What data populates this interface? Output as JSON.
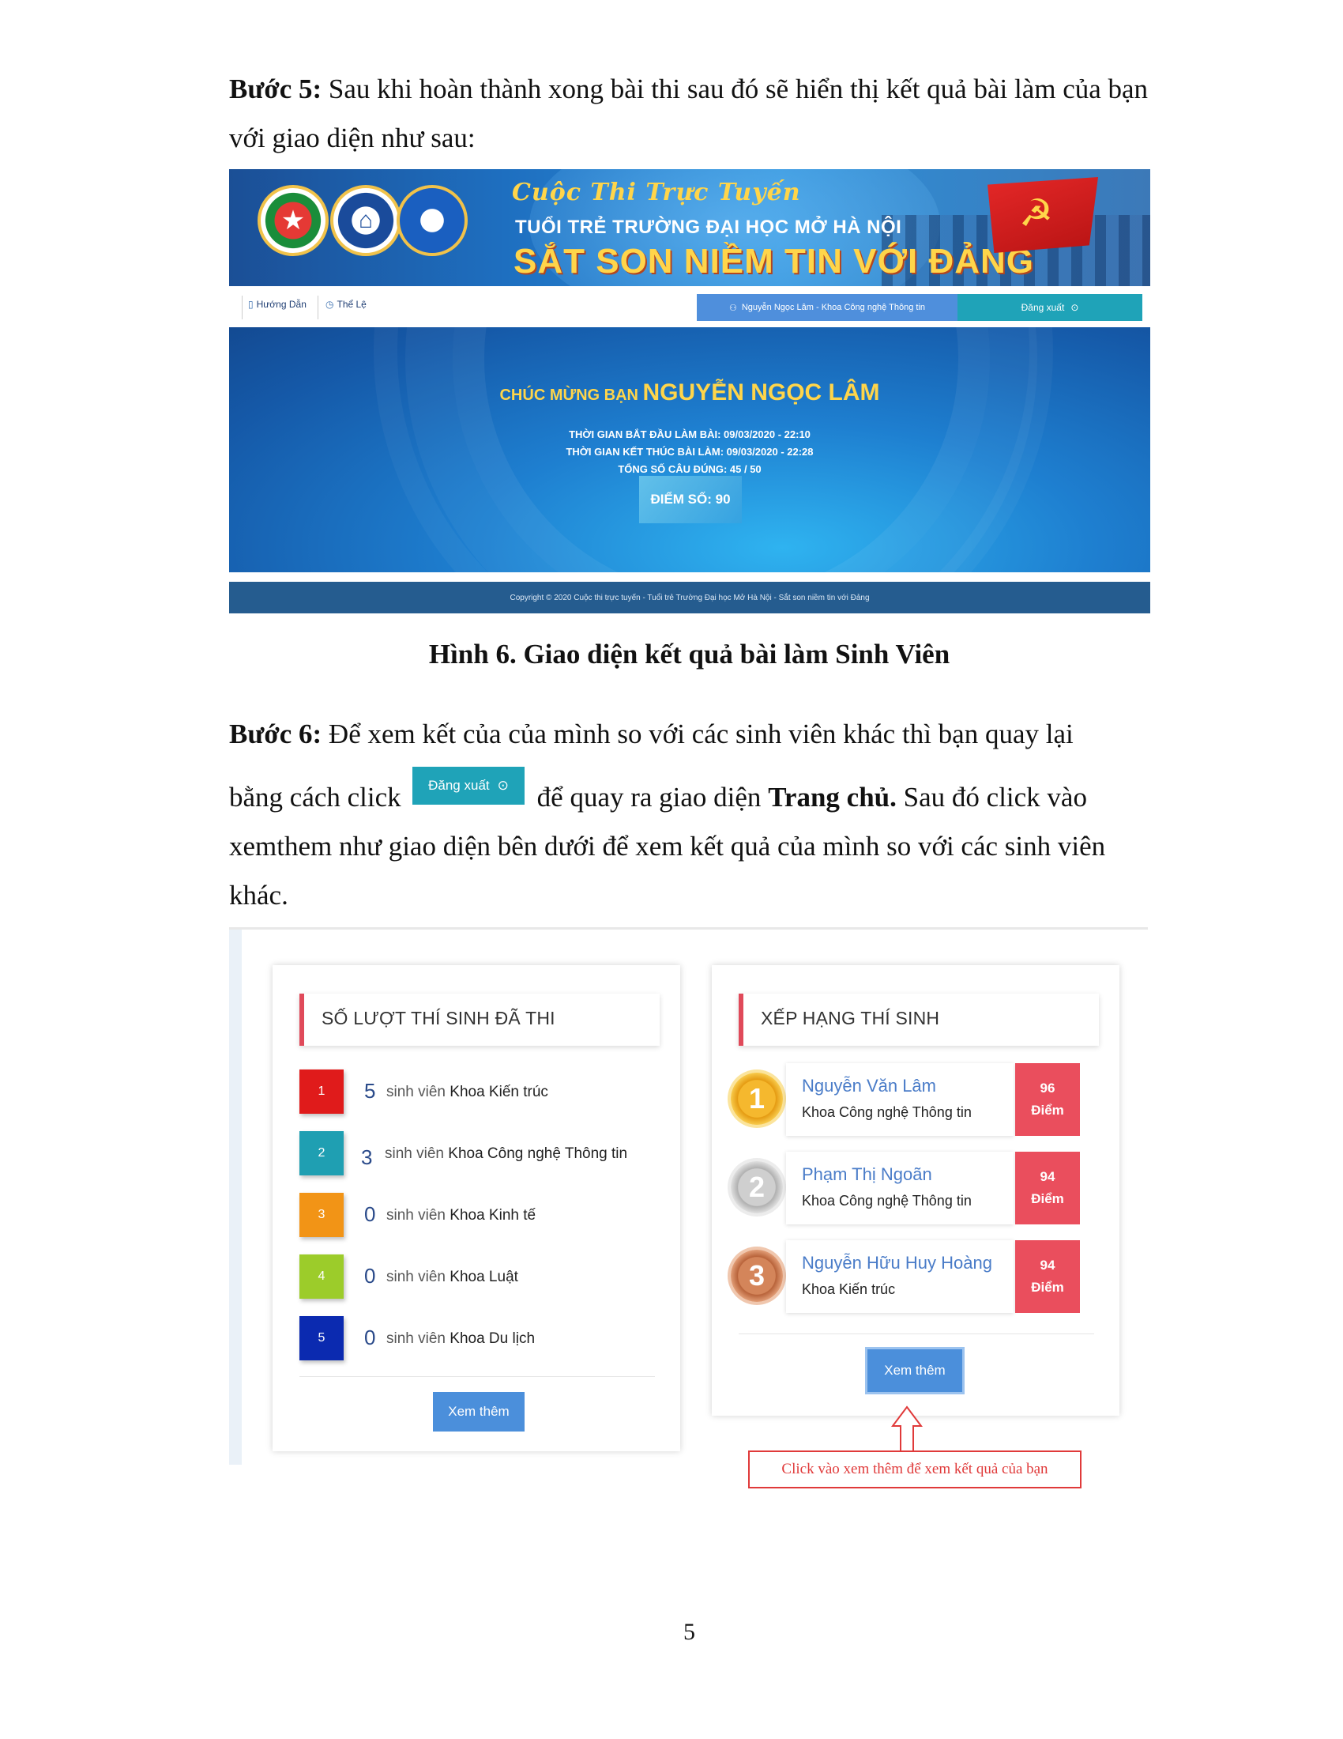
{
  "doc": {
    "step5_label": "Bước 5:",
    "step5_text": " Sau khi hoàn thành xong bài thi sau đó sẽ hiển thị kết quả bài làm của bạn với giao diện như sau:",
    "figure_caption": "Hình  6. Giao diện kết quả bài làm Sinh Viên",
    "step6_label": "Bước 6:",
    "step6_text_a": " Để xem kết của của mình so với các sinh viên khác thì bạn quay lại",
    "step6_text_b": "bằng cách click",
    "step6_text_c": "để quay ra giao diện ",
    "step6_bold": "Trang chủ.",
    "step6_text_d": " Sau đó click vào",
    "step6_text_e": "xemthem như giao diện bên dưới để xem kết quả của mình so với các sinh viên khác.",
    "page_number": "5"
  },
  "shot1": {
    "banner": {
      "line1": "Cuộc Thi Trực Tuyến",
      "line2": "TUỔI TRẺ TRƯỜNG ĐẠI HỌC MỞ HÀ NỘI",
      "line3": "SẮT SON NIỀM TIN VỚI ĐẢNG"
    },
    "nav": {
      "guide": "Hướng Dẫn",
      "rules": "Thể Lệ",
      "user": "Nguyễn Ngọc Lâm - Khoa Công nghệ Thông tin",
      "logout": "Đăng xuất"
    },
    "result": {
      "congrats_prefix": "CHÚC MỪNG BẠN ",
      "name": "NGUYỄN NGỌC LÂM",
      "start": "THỜI GIAN BẮT ĐẦU LÀM BÀI: 09/03/2020 - 22:10",
      "end": "THỜI GIAN KẾT THÚC BÀI LÀM: 09/03/2020 - 22:28",
      "correct": "TỔNG SỐ CÂU ĐÚNG: 45 / 50",
      "score": "ĐIỂM SỐ: 90"
    },
    "footer": "Copyright © 2020 Cuộc thi trực tuyến - Tuổi trẻ Trường Đại học Mở Hà Nội - Sắt son niềm tin với Đảng"
  },
  "inline_button": {
    "label": "Đăng xuất"
  },
  "shot2": {
    "stats": {
      "title": "SỐ LƯỢT THÍ SINH ĐÃ THI",
      "unit": "sinh viên",
      "rows": [
        {
          "rank": "1",
          "count": "5",
          "dept": "Khoa Kiến trúc",
          "color": "#e01b1b"
        },
        {
          "rank": "2",
          "count": "3",
          "dept": "Khoa Công nghệ Thông tin",
          "color": "#1f9fb2"
        },
        {
          "rank": "3",
          "count": "0",
          "dept": "Khoa Kinh tế",
          "color": "#f29416"
        },
        {
          "rank": "4",
          "count": "0",
          "dept": "Khoa Luật",
          "color": "#9ccc2a"
        },
        {
          "rank": "5",
          "count": "0",
          "dept": "Khoa Du lịch",
          "color": "#0b2ab0"
        }
      ],
      "more": "Xem thêm"
    },
    "ranking": {
      "title": "XẾP HẠNG THÍ SINH",
      "rows": [
        {
          "place": "1",
          "name": "Nguyễn Văn Lâm",
          "dept": "Khoa Công nghệ Thông tin",
          "score": "96",
          "unit": "Điểm"
        },
        {
          "place": "2",
          "name": "Phạm Thị Ngoãn",
          "dept": "Khoa Công nghệ Thông tin",
          "score": "94",
          "unit": "Điểm"
        },
        {
          "place": "3",
          "name": "Nguyễn Hữu Huy Hoàng",
          "dept": "Khoa Kiến trúc",
          "score": "94",
          "unit": "Điểm"
        }
      ],
      "more": "Xem thêm"
    },
    "note": "Click vào xem thêm để xem kết quả của bạn"
  }
}
